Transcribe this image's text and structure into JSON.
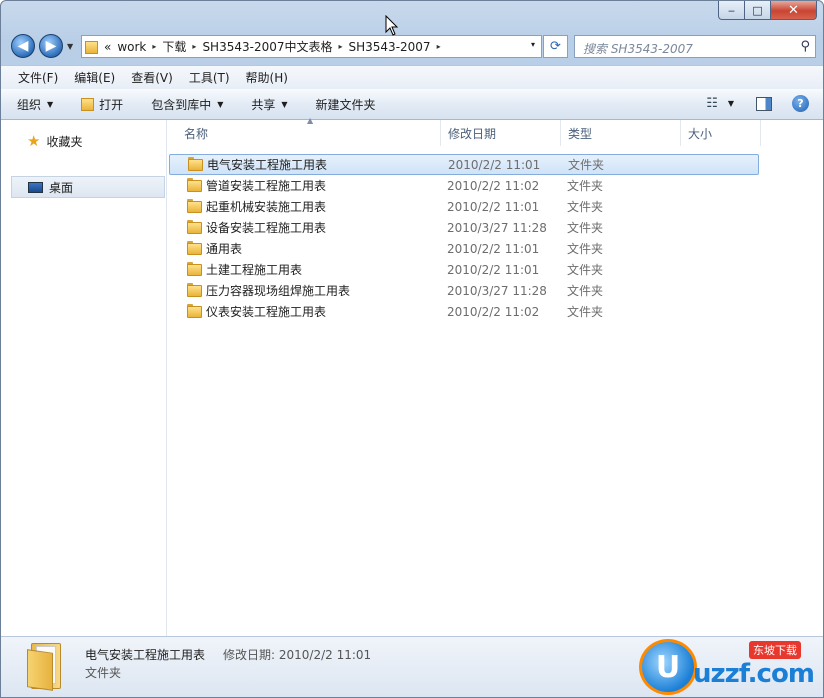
{
  "window": {
    "caption": {
      "minimize": "‒",
      "maximize": "□",
      "close": "✕"
    }
  },
  "address": {
    "overflow": "«",
    "segments": [
      "work",
      "下载",
      "SH3543-2007中文表格",
      "SH3543-2007"
    ],
    "separator": "▸",
    "dropdown": "▾"
  },
  "search": {
    "placeholder": "搜索 SH3543-2007"
  },
  "menu": [
    "文件(F)",
    "编辑(E)",
    "查看(V)",
    "工具(T)",
    "帮助(H)"
  ],
  "toolbar": {
    "organize": "组织",
    "open": "打开",
    "include_library": "包含到库中",
    "share": "共享",
    "new_folder": "新建文件夹"
  },
  "navpane": {
    "favorites": "收藏夹",
    "desktop": "桌面"
  },
  "columns": {
    "name": "名称",
    "date": "修改日期",
    "type": "类型",
    "size": "大小"
  },
  "files": [
    {
      "name": "电气安装工程施工用表",
      "date": "2010/2/2 11:01",
      "type": "文件夹",
      "selected": true
    },
    {
      "name": "管道安装工程施工用表",
      "date": "2010/2/2 11:02",
      "type": "文件夹"
    },
    {
      "name": "起重机械安装施工用表",
      "date": "2010/2/2 11:01",
      "type": "文件夹"
    },
    {
      "name": "设备安装工程施工用表",
      "date": "2010/3/27 11:28",
      "type": "文件夹"
    },
    {
      "name": "通用表",
      "date": "2010/2/2 11:01",
      "type": "文件夹"
    },
    {
      "name": "土建工程施工用表",
      "date": "2010/2/2 11:01",
      "type": "文件夹"
    },
    {
      "name": "压力容器现场组焊施工用表",
      "date": "2010/3/27 11:28",
      "type": "文件夹"
    },
    {
      "name": "仪表安装工程施工用表",
      "date": "2010/2/2 11:02",
      "type": "文件夹"
    }
  ],
  "status": {
    "name": "电气安装工程施工用表",
    "meta": "修改日期: 2010/2/2 11:01",
    "type": "文件夹"
  },
  "watermark": {
    "text": "uzzf.com",
    "tag": "东坡下载",
    "letter": "U"
  }
}
